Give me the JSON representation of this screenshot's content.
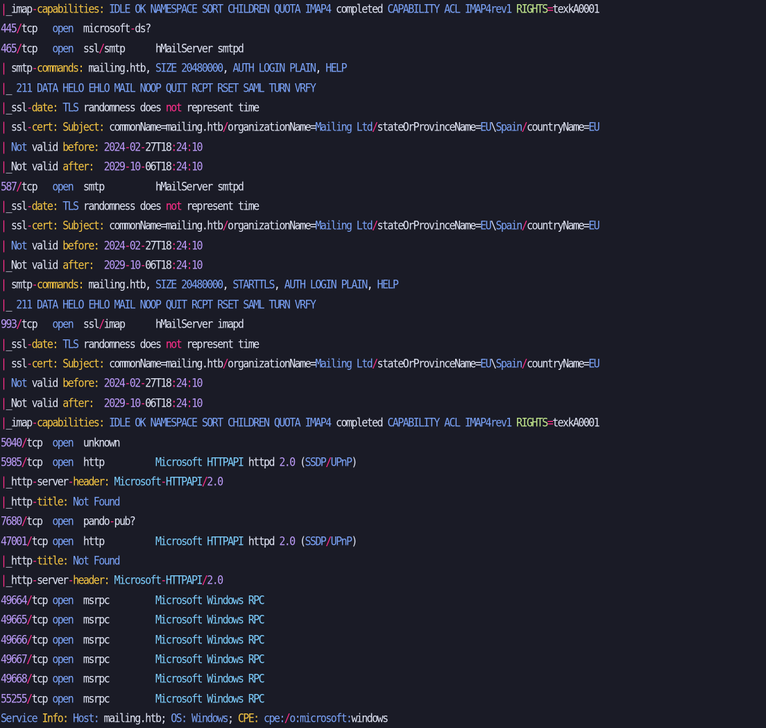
{
  "terminal": {
    "lines": [
      [
        [
          "p",
          "|"
        ],
        [
          "w",
          "_imap"
        ],
        [
          "p",
          "-"
        ],
        [
          "y",
          "capabilities:"
        ],
        [
          "b",
          " IDLE OK NAMESPACE SORT CHILDREN QUOTA IMAP4"
        ],
        [
          "w",
          " completed"
        ],
        [
          "b",
          " CAPABILITY ACL IMAP4rev1"
        ],
        [
          "g",
          " RIGHTS"
        ],
        [
          "p",
          "="
        ],
        [
          "w",
          "texkA0001"
        ]
      ],
      [
        [
          "n",
          "445"
        ],
        [
          "p",
          "/"
        ],
        [
          "w",
          "tcp   "
        ],
        [
          "b",
          "open"
        ],
        [
          "w",
          "  microsoft"
        ],
        [
          "p",
          "-"
        ],
        [
          "w",
          "ds?"
        ]
      ],
      [
        [
          "n",
          "465"
        ],
        [
          "p",
          "/"
        ],
        [
          "w",
          "tcp   "
        ],
        [
          "b",
          "open"
        ],
        [
          "w",
          "  ssl"
        ],
        [
          "p",
          "/"
        ],
        [
          "w",
          "smtp      hMailServer smtpd"
        ]
      ],
      [
        [
          "p",
          "|"
        ],
        [
          "w",
          " smtp"
        ],
        [
          "p",
          "-"
        ],
        [
          "y",
          "commands:"
        ],
        [
          "w",
          " mailing.htb,"
        ],
        [
          "b",
          " SIZE 20480000"
        ],
        [
          "w",
          ","
        ],
        [
          "b",
          " AUTH LOGIN PLAIN"
        ],
        [
          "w",
          ","
        ],
        [
          "b",
          " HELP"
        ]
      ],
      [
        [
          "p",
          "|"
        ],
        [
          "w",
          "_"
        ],
        [
          "b",
          " 211 DATA HELO EHLO MAIL NOOP QUIT RCPT RSET SAML TURN VRFY"
        ]
      ],
      [
        [
          "p",
          "|"
        ],
        [
          "w",
          "_ssl"
        ],
        [
          "p",
          "-"
        ],
        [
          "y",
          "date:"
        ],
        [
          "b",
          " TLS"
        ],
        [
          "w",
          " randomness does "
        ],
        [
          "p",
          "not"
        ],
        [
          "w",
          " represent time"
        ]
      ],
      [
        [
          "p",
          "|"
        ],
        [
          "w",
          " ssl"
        ],
        [
          "p",
          "-"
        ],
        [
          "y",
          "cert:"
        ],
        [
          "y",
          " Subject:"
        ],
        [
          "w",
          " commonName=mailing.htb"
        ],
        [
          "p",
          "/"
        ],
        [
          "w",
          "organizationName="
        ],
        [
          "b",
          "Mailing Ltd"
        ],
        [
          "p",
          "/"
        ],
        [
          "w",
          "stateOrProvinceName="
        ],
        [
          "b",
          "EU"
        ],
        [
          "w",
          "\\"
        ],
        [
          "b",
          "Spain"
        ],
        [
          "p",
          "/"
        ],
        [
          "w",
          "countryName="
        ],
        [
          "b",
          "EU"
        ]
      ],
      [
        [
          "p",
          "|"
        ],
        [
          "b",
          " Not"
        ],
        [
          "w",
          " valid "
        ],
        [
          "y",
          "before:"
        ],
        [
          "v",
          " 2024"
        ],
        [
          "p",
          "-"
        ],
        [
          "v",
          "02"
        ],
        [
          "p",
          "-"
        ],
        [
          "w",
          "27T18"
        ],
        [
          "p",
          ":"
        ],
        [
          "v",
          "24"
        ],
        [
          "p",
          ":"
        ],
        [
          "v",
          "10"
        ]
      ],
      [
        [
          "p",
          "|"
        ],
        [
          "w",
          "_Not valid "
        ],
        [
          "y",
          "after:"
        ],
        [
          "v",
          "  2029"
        ],
        [
          "p",
          "-"
        ],
        [
          "v",
          "10"
        ],
        [
          "p",
          "-"
        ],
        [
          "w",
          "06T18"
        ],
        [
          "p",
          ":"
        ],
        [
          "v",
          "24"
        ],
        [
          "p",
          ":"
        ],
        [
          "v",
          "10"
        ]
      ],
      [
        [
          "n",
          "587"
        ],
        [
          "p",
          "/"
        ],
        [
          "w",
          "tcp   "
        ],
        [
          "b",
          "open"
        ],
        [
          "w",
          "  smtp          hMailServer smtpd"
        ]
      ],
      [
        [
          "p",
          "|"
        ],
        [
          "w",
          "_ssl"
        ],
        [
          "p",
          "-"
        ],
        [
          "y",
          "date:"
        ],
        [
          "b",
          " TLS"
        ],
        [
          "w",
          " randomness does "
        ],
        [
          "p",
          "not"
        ],
        [
          "w",
          " represent time"
        ]
      ],
      [
        [
          "p",
          "|"
        ],
        [
          "w",
          " ssl"
        ],
        [
          "p",
          "-"
        ],
        [
          "y",
          "cert:"
        ],
        [
          "y",
          " Subject:"
        ],
        [
          "w",
          " commonName=mailing.htb"
        ],
        [
          "p",
          "/"
        ],
        [
          "w",
          "organizationName="
        ],
        [
          "b",
          "Mailing Ltd"
        ],
        [
          "p",
          "/"
        ],
        [
          "w",
          "stateOrProvinceName="
        ],
        [
          "b",
          "EU"
        ],
        [
          "w",
          "\\"
        ],
        [
          "b",
          "Spain"
        ],
        [
          "p",
          "/"
        ],
        [
          "w",
          "countryName="
        ],
        [
          "b",
          "EU"
        ]
      ],
      [
        [
          "p",
          "|"
        ],
        [
          "b",
          " Not"
        ],
        [
          "w",
          " valid "
        ],
        [
          "y",
          "before:"
        ],
        [
          "v",
          " 2024"
        ],
        [
          "p",
          "-"
        ],
        [
          "v",
          "02"
        ],
        [
          "p",
          "-"
        ],
        [
          "w",
          "27T18"
        ],
        [
          "p",
          ":"
        ],
        [
          "v",
          "24"
        ],
        [
          "p",
          ":"
        ],
        [
          "v",
          "10"
        ]
      ],
      [
        [
          "p",
          "|"
        ],
        [
          "w",
          "_Not valid "
        ],
        [
          "y",
          "after:"
        ],
        [
          "v",
          "  2029"
        ],
        [
          "p",
          "-"
        ],
        [
          "v",
          "10"
        ],
        [
          "p",
          "-"
        ],
        [
          "w",
          "06T18"
        ],
        [
          "p",
          ":"
        ],
        [
          "v",
          "24"
        ],
        [
          "p",
          ":"
        ],
        [
          "v",
          "10"
        ]
      ],
      [
        [
          "p",
          "|"
        ],
        [
          "w",
          " smtp"
        ],
        [
          "p",
          "-"
        ],
        [
          "y",
          "commands:"
        ],
        [
          "w",
          " mailing.htb,"
        ],
        [
          "b",
          " SIZE 20480000"
        ],
        [
          "w",
          ","
        ],
        [
          "b",
          " STARTTLS"
        ],
        [
          "w",
          ","
        ],
        [
          "b",
          " AUTH LOGIN PLAIN"
        ],
        [
          "w",
          ","
        ],
        [
          "b",
          " HELP"
        ]
      ],
      [
        [
          "p",
          "|"
        ],
        [
          "w",
          "_"
        ],
        [
          "b",
          " 211 DATA HELO EHLO MAIL NOOP QUIT RCPT RSET SAML TURN VRFY"
        ]
      ],
      [
        [
          "n",
          "993"
        ],
        [
          "p",
          "/"
        ],
        [
          "w",
          "tcp   "
        ],
        [
          "b",
          "open"
        ],
        [
          "w",
          "  ssl"
        ],
        [
          "p",
          "/"
        ],
        [
          "w",
          "imap      hMailServer imapd"
        ]
      ],
      [
        [
          "p",
          "|"
        ],
        [
          "w",
          "_ssl"
        ],
        [
          "p",
          "-"
        ],
        [
          "y",
          "date:"
        ],
        [
          "b",
          " TLS"
        ],
        [
          "w",
          " randomness does "
        ],
        [
          "p",
          "not"
        ],
        [
          "w",
          " represent time"
        ]
      ],
      [
        [
          "p",
          "|"
        ],
        [
          "w",
          " ssl"
        ],
        [
          "p",
          "-"
        ],
        [
          "y",
          "cert:"
        ],
        [
          "y",
          " Subject:"
        ],
        [
          "w",
          " commonName=mailing.htb"
        ],
        [
          "p",
          "/"
        ],
        [
          "w",
          "organizationName="
        ],
        [
          "b",
          "Mailing Ltd"
        ],
        [
          "p",
          "/"
        ],
        [
          "w",
          "stateOrProvinceName="
        ],
        [
          "b",
          "EU"
        ],
        [
          "w",
          "\\"
        ],
        [
          "b",
          "Spain"
        ],
        [
          "p",
          "/"
        ],
        [
          "w",
          "countryName="
        ],
        [
          "b",
          "EU"
        ]
      ],
      [
        [
          "p",
          "|"
        ],
        [
          "b",
          " Not"
        ],
        [
          "w",
          " valid "
        ],
        [
          "y",
          "before:"
        ],
        [
          "v",
          " 2024"
        ],
        [
          "p",
          "-"
        ],
        [
          "v",
          "02"
        ],
        [
          "p",
          "-"
        ],
        [
          "w",
          "27T18"
        ],
        [
          "p",
          ":"
        ],
        [
          "v",
          "24"
        ],
        [
          "p",
          ":"
        ],
        [
          "v",
          "10"
        ]
      ],
      [
        [
          "p",
          "|"
        ],
        [
          "w",
          "_Not valid "
        ],
        [
          "y",
          "after:"
        ],
        [
          "v",
          "  2029"
        ],
        [
          "p",
          "-"
        ],
        [
          "v",
          "10"
        ],
        [
          "p",
          "-"
        ],
        [
          "w",
          "06T18"
        ],
        [
          "p",
          ":"
        ],
        [
          "v",
          "24"
        ],
        [
          "p",
          ":"
        ],
        [
          "v",
          "10"
        ]
      ],
      [
        [
          "p",
          "|"
        ],
        [
          "w",
          "_imap"
        ],
        [
          "p",
          "-"
        ],
        [
          "y",
          "capabilities:"
        ],
        [
          "b",
          " IDLE OK NAMESPACE SORT CHILDREN QUOTA IMAP4"
        ],
        [
          "w",
          " completed"
        ],
        [
          "b",
          " CAPABILITY ACL IMAP4rev1"
        ],
        [
          "g",
          " RIGHTS"
        ],
        [
          "p",
          "="
        ],
        [
          "w",
          "texkA0001"
        ]
      ],
      [
        [
          "n",
          "5040"
        ],
        [
          "p",
          "/"
        ],
        [
          "w",
          "tcp  "
        ],
        [
          "b",
          "open"
        ],
        [
          "w",
          "  unknown"
        ]
      ],
      [
        [
          "n",
          "5985"
        ],
        [
          "p",
          "/"
        ],
        [
          "w",
          "tcp  "
        ],
        [
          "b",
          "open"
        ],
        [
          "w",
          "  http          "
        ],
        [
          "c",
          "Microsoft HTTPAPI"
        ],
        [
          "w",
          " httpd "
        ],
        [
          "v",
          "2.0"
        ],
        [
          "w",
          " ("
        ],
        [
          "b",
          "SSDP"
        ],
        [
          "p",
          "/"
        ],
        [
          "b",
          "UPnP"
        ],
        [
          "w",
          ")"
        ]
      ],
      [
        [
          "p",
          "|"
        ],
        [
          "w",
          "_http"
        ],
        [
          "p",
          "-"
        ],
        [
          "w",
          "server"
        ],
        [
          "p",
          "-"
        ],
        [
          "y",
          "header:"
        ],
        [
          "c",
          " Microsoft"
        ],
        [
          "p",
          "-"
        ],
        [
          "c",
          "HTTPAPI"
        ],
        [
          "p",
          "/"
        ],
        [
          "v",
          "2.0"
        ]
      ],
      [
        [
          "p",
          "|"
        ],
        [
          "w",
          "_http"
        ],
        [
          "p",
          "-"
        ],
        [
          "y",
          "title:"
        ],
        [
          "b",
          " Not Found"
        ]
      ],
      [
        [
          "n",
          "7680"
        ],
        [
          "p",
          "/"
        ],
        [
          "w",
          "tcp  "
        ],
        [
          "b",
          "open"
        ],
        [
          "w",
          "  pando"
        ],
        [
          "p",
          "-"
        ],
        [
          "w",
          "pub?"
        ]
      ],
      [
        [
          "n",
          "47001"
        ],
        [
          "p",
          "/"
        ],
        [
          "w",
          "tcp "
        ],
        [
          "b",
          "open"
        ],
        [
          "w",
          "  http          "
        ],
        [
          "c",
          "Microsoft HTTPAPI"
        ],
        [
          "w",
          " httpd "
        ],
        [
          "v",
          "2.0"
        ],
        [
          "w",
          " ("
        ],
        [
          "b",
          "SSDP"
        ],
        [
          "p",
          "/"
        ],
        [
          "b",
          "UPnP"
        ],
        [
          "w",
          ")"
        ]
      ],
      [
        [
          "p",
          "|"
        ],
        [
          "w",
          "_http"
        ],
        [
          "p",
          "-"
        ],
        [
          "y",
          "title:"
        ],
        [
          "b",
          " Not Found"
        ]
      ],
      [
        [
          "p",
          "|"
        ],
        [
          "w",
          "_http"
        ],
        [
          "p",
          "-"
        ],
        [
          "w",
          "server"
        ],
        [
          "p",
          "-"
        ],
        [
          "y",
          "header:"
        ],
        [
          "c",
          " Microsoft"
        ],
        [
          "p",
          "-"
        ],
        [
          "c",
          "HTTPAPI"
        ],
        [
          "p",
          "/"
        ],
        [
          "v",
          "2.0"
        ]
      ],
      [
        [
          "n",
          "49664"
        ],
        [
          "p",
          "/"
        ],
        [
          "w",
          "tcp "
        ],
        [
          "b",
          "open"
        ],
        [
          "w",
          "  msrpc         "
        ],
        [
          "c",
          "Microsoft Windows RPC"
        ]
      ],
      [
        [
          "n",
          "49665"
        ],
        [
          "p",
          "/"
        ],
        [
          "w",
          "tcp "
        ],
        [
          "b",
          "open"
        ],
        [
          "w",
          "  msrpc         "
        ],
        [
          "c",
          "Microsoft Windows RPC"
        ]
      ],
      [
        [
          "n",
          "49666"
        ],
        [
          "p",
          "/"
        ],
        [
          "w",
          "tcp "
        ],
        [
          "b",
          "open"
        ],
        [
          "w",
          "  msrpc         "
        ],
        [
          "c",
          "Microsoft Windows RPC"
        ]
      ],
      [
        [
          "n",
          "49667"
        ],
        [
          "p",
          "/"
        ],
        [
          "w",
          "tcp "
        ],
        [
          "b",
          "open"
        ],
        [
          "w",
          "  msrpc         "
        ],
        [
          "c",
          "Microsoft Windows RPC"
        ]
      ],
      [
        [
          "n",
          "49668"
        ],
        [
          "p",
          "/"
        ],
        [
          "w",
          "tcp "
        ],
        [
          "b",
          "open"
        ],
        [
          "w",
          "  msrpc         "
        ],
        [
          "c",
          "Microsoft Windows RPC"
        ]
      ],
      [
        [
          "n",
          "55255"
        ],
        [
          "p",
          "/"
        ],
        [
          "w",
          "tcp "
        ],
        [
          "b",
          "open"
        ],
        [
          "w",
          "  msrpc         "
        ],
        [
          "c",
          "Microsoft Windows RPC"
        ]
      ],
      [
        [
          "b",
          "Service"
        ],
        [
          "y",
          " Info:"
        ],
        [
          "b",
          " Host:"
        ],
        [
          "w",
          " mailing.htb; "
        ],
        [
          "b",
          "OS:"
        ],
        [
          "b",
          " Windows"
        ],
        [
          "w",
          "; "
        ],
        [
          "y",
          "CPE:"
        ],
        [
          "b",
          " cpe:"
        ],
        [
          "p",
          "/"
        ],
        [
          "b",
          "o:microsoft:"
        ],
        [
          "w",
          "windows"
        ]
      ]
    ]
  }
}
